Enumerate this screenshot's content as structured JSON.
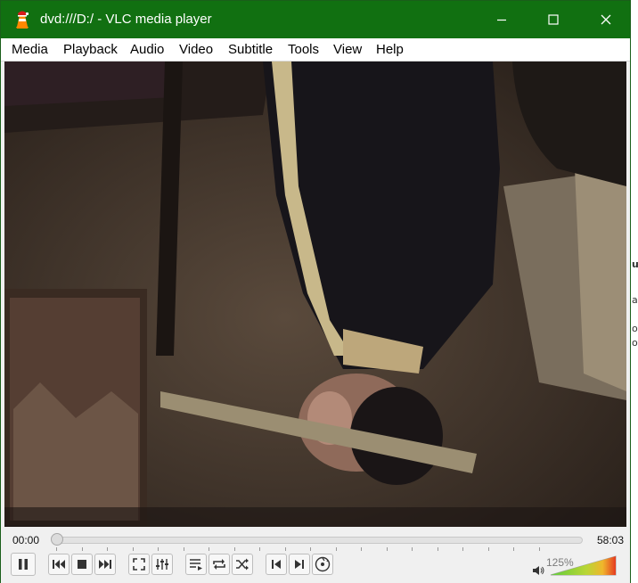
{
  "window": {
    "title": "dvd:///D:/ - VLC media player",
    "title_bar_color": "#117011",
    "controls": [
      "minimize-icon",
      "maximize-icon",
      "close-icon"
    ]
  },
  "menu": [
    "Media",
    "Playback",
    "Audio",
    "Video",
    "Subtitle",
    "Tools",
    "View",
    "Help"
  ],
  "player": {
    "elapsed": "00:00",
    "duration": "58:03",
    "seek_progress": 0.0,
    "volume_label": "125%",
    "volume_level": 1.25,
    "buttons": [
      "pause-icon",
      "previous-chapter-icon",
      "stop-icon",
      "next-chapter-icon",
      "fullscreen-icon",
      "extended-settings-icon",
      "playlist-icon",
      "loop-icon",
      "shuffle-icon",
      "previous-frame-icon",
      "next-frame-icon",
      "dvd-menu-icon"
    ]
  },
  "background_glyphs": [
    "u",
    "a",
    "o",
    "o"
  ]
}
